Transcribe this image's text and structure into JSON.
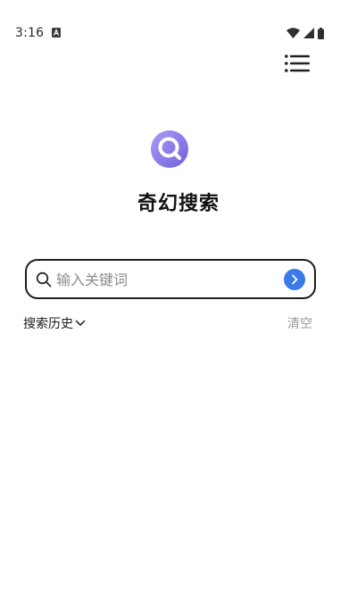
{
  "status_bar": {
    "time": "3:16",
    "icons": [
      "notification-a-icon",
      "wifi-icon",
      "cell-signal-icon",
      "battery-icon"
    ]
  },
  "header": {
    "menu_icon": "list-menu-icon"
  },
  "app": {
    "title": "奇幻搜索",
    "logo_icon": "magnifier-logo-icon",
    "accent_color": "#8b7fe8"
  },
  "search": {
    "placeholder": "输入关键词",
    "value": "",
    "submit_icon": "chevron-right-icon",
    "submit_color": "#3b7be8"
  },
  "history": {
    "label": "搜索历史",
    "toggle_icon": "chevron-down-icon",
    "clear_label": "清空",
    "items": []
  }
}
